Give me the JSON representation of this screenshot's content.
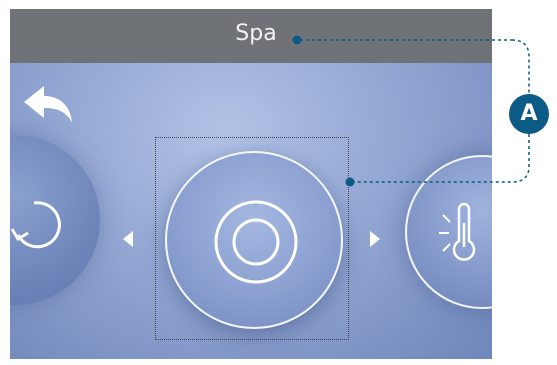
{
  "header": {
    "title": "Spa"
  },
  "icons": {
    "back": "back-arrow-icon",
    "prev": "chevron-left-icon",
    "next": "chevron-right-icon",
    "left_tile": "rotate-icon",
    "center_tile": "target-icon",
    "right_tile": "thermometer-icon"
  },
  "callout": {
    "label": "A"
  },
  "colors": {
    "titlebar": "#6f7276",
    "screen_bg": "#93a7d3",
    "callout": "#0c5a86",
    "icon": "#ffffff"
  }
}
